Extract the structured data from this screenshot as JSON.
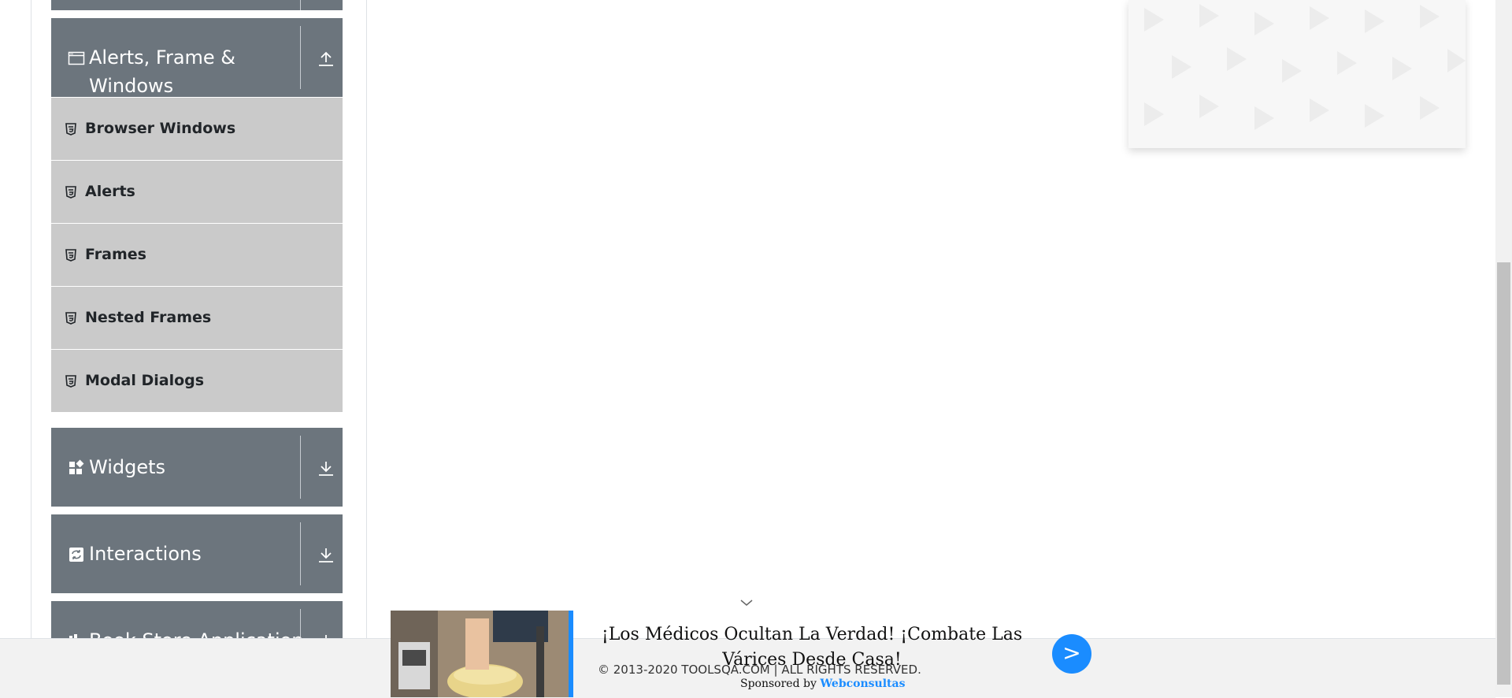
{
  "sidebar": {
    "alerts_group": {
      "title_line1": "Alerts, Frame &",
      "title_line2": "Windows",
      "icon": "window-icon",
      "arrow": "collapse-arrow-icon"
    },
    "alerts_items": [
      {
        "label": "Browser Windows"
      },
      {
        "label": "Alerts"
      },
      {
        "label": "Frames"
      },
      {
        "label": "Nested Frames"
      },
      {
        "label": "Modal Dialogs"
      }
    ],
    "widgets_group": {
      "title": "Widgets",
      "icon": "widgets-icon",
      "arrow": "expand-arrow-icon"
    },
    "interactions_group": {
      "title": "Interactions",
      "icon": "interactions-icon",
      "arrow": "expand-arrow-icon"
    },
    "bookstore_group": {
      "title": "Book Store Application",
      "icon": "bookstore-icon",
      "arrow": "expand-arrow-icon"
    }
  },
  "footer": {
    "copyright": "© 2013-2020 TOOLSQA.COM | ALL RIGHTS RESERVED."
  },
  "ad": {
    "headline": "¡Los Médicos Ocultan La Verdad! ¡Combate Las Várices Desde Casa!",
    "sponsor_prefix": "Sponsored by",
    "sponsor_name": "Webconsultas",
    "go_label": ">",
    "accent_color": "#1a8cff"
  },
  "colors": {
    "group_bg": "#6c757d",
    "item_bg": "#cacaca"
  }
}
